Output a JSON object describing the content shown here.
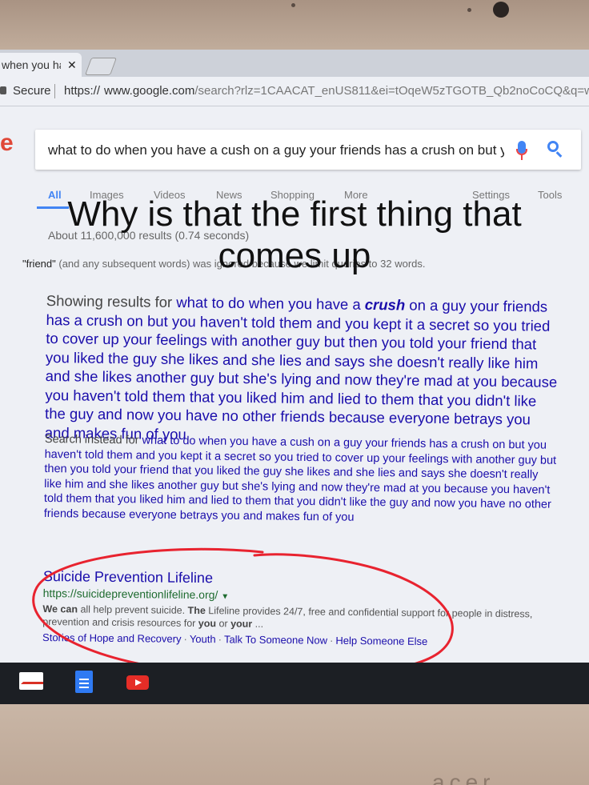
{
  "browser": {
    "tab_title": "when you ha",
    "tab_close": "✕",
    "secure_label": "Secure",
    "url_scheme": "https://",
    "url_host": "www.google.com",
    "url_path": "/search?rlz=1CAACAT_enUS811&ei=tOqeW5zTGOTB_Qb2noCoCQ&q=wh"
  },
  "google": {
    "logo_fragment": "e",
    "query": "what to do when you have a cush on a guy your friends has a crush on but y",
    "tabs": [
      "All",
      "Images",
      "Videos",
      "News",
      "Shopping",
      "More",
      "Settings",
      "Tools"
    ],
    "result_stats": "About 11,600,000 results (0.74 seconds)",
    "ignored_note_quote": "\"friend\"",
    "ignored_note_rest": " (and any subsequent words) was ignored because we limit queries to 32 words."
  },
  "caption": {
    "line1": "Why is that the first thing that",
    "line2": "comes up"
  },
  "correction": {
    "showing_prefix": "Showing results for ",
    "showing_part1": "what to do when you have a ",
    "showing_bold": "crush",
    "showing_part2": " on a guy your friends has a crush on but you haven't told them and you kept it a secret so you tried to cover up your feelings with another guy but then you told your friend that you liked the guy she likes and she lies and says she doesn't really like him and she likes another guy but she's lying and now they're mad at you because you haven't told them that you liked him and lied to them that you didn't like the guy and now you have no other friends because everyone betrays you and makes fun of you",
    "instead_prefix": "Search instead for ",
    "instead_query": "what to do when you have a cush on a guy your friends has a crush on but you haven't told them and you kept it a secret so you tried to cover up your feelings with another guy but then you told your friend that you liked the guy she likes and she lies and says she doesn't really like him and she likes another guy but she's lying and now they're mad at you because you haven't told them that you liked him and lied to them that you didn't like the guy and now you have no other friends because everyone betrays you and makes fun of you"
  },
  "result": {
    "title": "Suicide Prevention Lifeline",
    "url": "https://suicidepreventionlifeline.org/",
    "snippet_bold1": "We can",
    "snippet_1": " all help prevent suicide. ",
    "snippet_bold2": "The",
    "snippet_2": " Lifeline provides 24/7, free and confidential support for people in distress, prevention and crisis resources for ",
    "snippet_bold3": "you",
    "snippet_3": " or ",
    "snippet_bold4": "your",
    "snippet_4": " ...",
    "sitelinks": [
      "Stories of Hope and Recovery",
      "Youth",
      "Talk To Someone Now",
      "Help Someone Else"
    ]
  },
  "brand": "acer",
  "colors": {
    "link": "#1a0dab",
    "url_green": "#1e6b2f",
    "accent_blue": "#4285f4",
    "annotation_red": "#e8232f"
  }
}
